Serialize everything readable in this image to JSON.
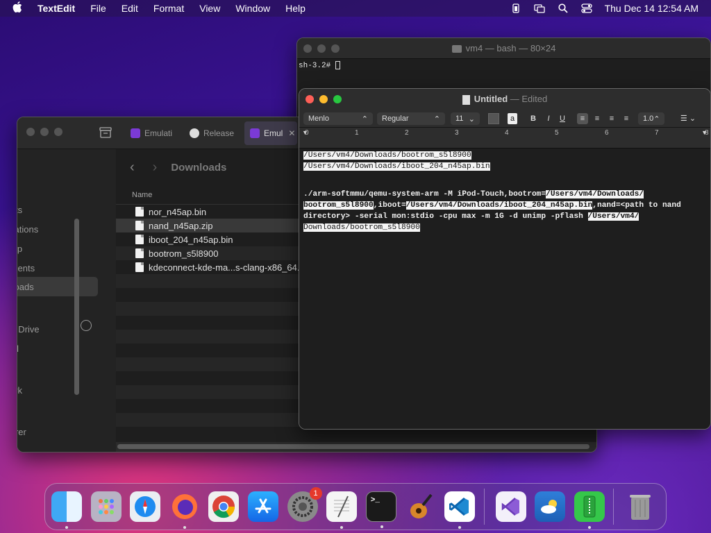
{
  "menubar": {
    "app": "TextEdit",
    "items": [
      "File",
      "Edit",
      "Format",
      "View",
      "Window",
      "Help"
    ],
    "clock": "Thu Dec 14  12:54 AM"
  },
  "terminal": {
    "title": "vm4 — bash — 80×24",
    "prompt": "sh-3.2# "
  },
  "finder": {
    "tabs": [
      {
        "label": "Emulati"
      },
      {
        "label": "Release"
      },
      {
        "label": "Emul"
      }
    ],
    "sidebar": [
      "s",
      "cents",
      "plications",
      "sktop",
      "cuments",
      "wnloads",
      "oud Drive",
      "ared",
      "ns",
      "twork",
      "wrerer",
      "h"
    ],
    "location": "Downloads",
    "column_name": "Name",
    "files": [
      "nor_n45ap.bin",
      "nand_n45ap.zip",
      "iboot_204_n45ap.bin",
      "bootrom_s5l8900",
      "kdeconnect-kde-ma...s-clang-x86_64.d"
    ]
  },
  "textedit": {
    "title": "Untitled",
    "status": "Edited",
    "font": "Menlo",
    "style": "Regular",
    "size": "11",
    "bold": "B",
    "italic": "I",
    "underline": "U",
    "spacing": "1.0",
    "ruler": [
      "0",
      "1",
      "2",
      "3",
      "4",
      "5",
      "6",
      "7",
      "8"
    ],
    "lines": {
      "l1": "/Users/vm4/Downloads/bootrom_s5l8900",
      "l2": "/Users/vm4/Downloads/iboot_204_n45ap.bin",
      "c1": "./arm-softmmu/qemu-system-arm -M iPod-Touch,bootrom=",
      "c1h": "/Users/vm4/Downloads/",
      "c2h": "bootrom_s5l8900",
      "c2a": ",iboot=",
      "c2h2": "/Users/vm4/Downloads/iboot_204_n45ap.bin",
      "c2b": ",nand=<path to nand",
      "c3a": "directory> -serial mon:stdio -cpu max -m 1G -d unimp -pflash ",
      "c3h": "/Users/vm4/",
      "c4h": "Downloads/bootrom_s5l8900"
    }
  },
  "dock": {
    "badge": "1"
  }
}
